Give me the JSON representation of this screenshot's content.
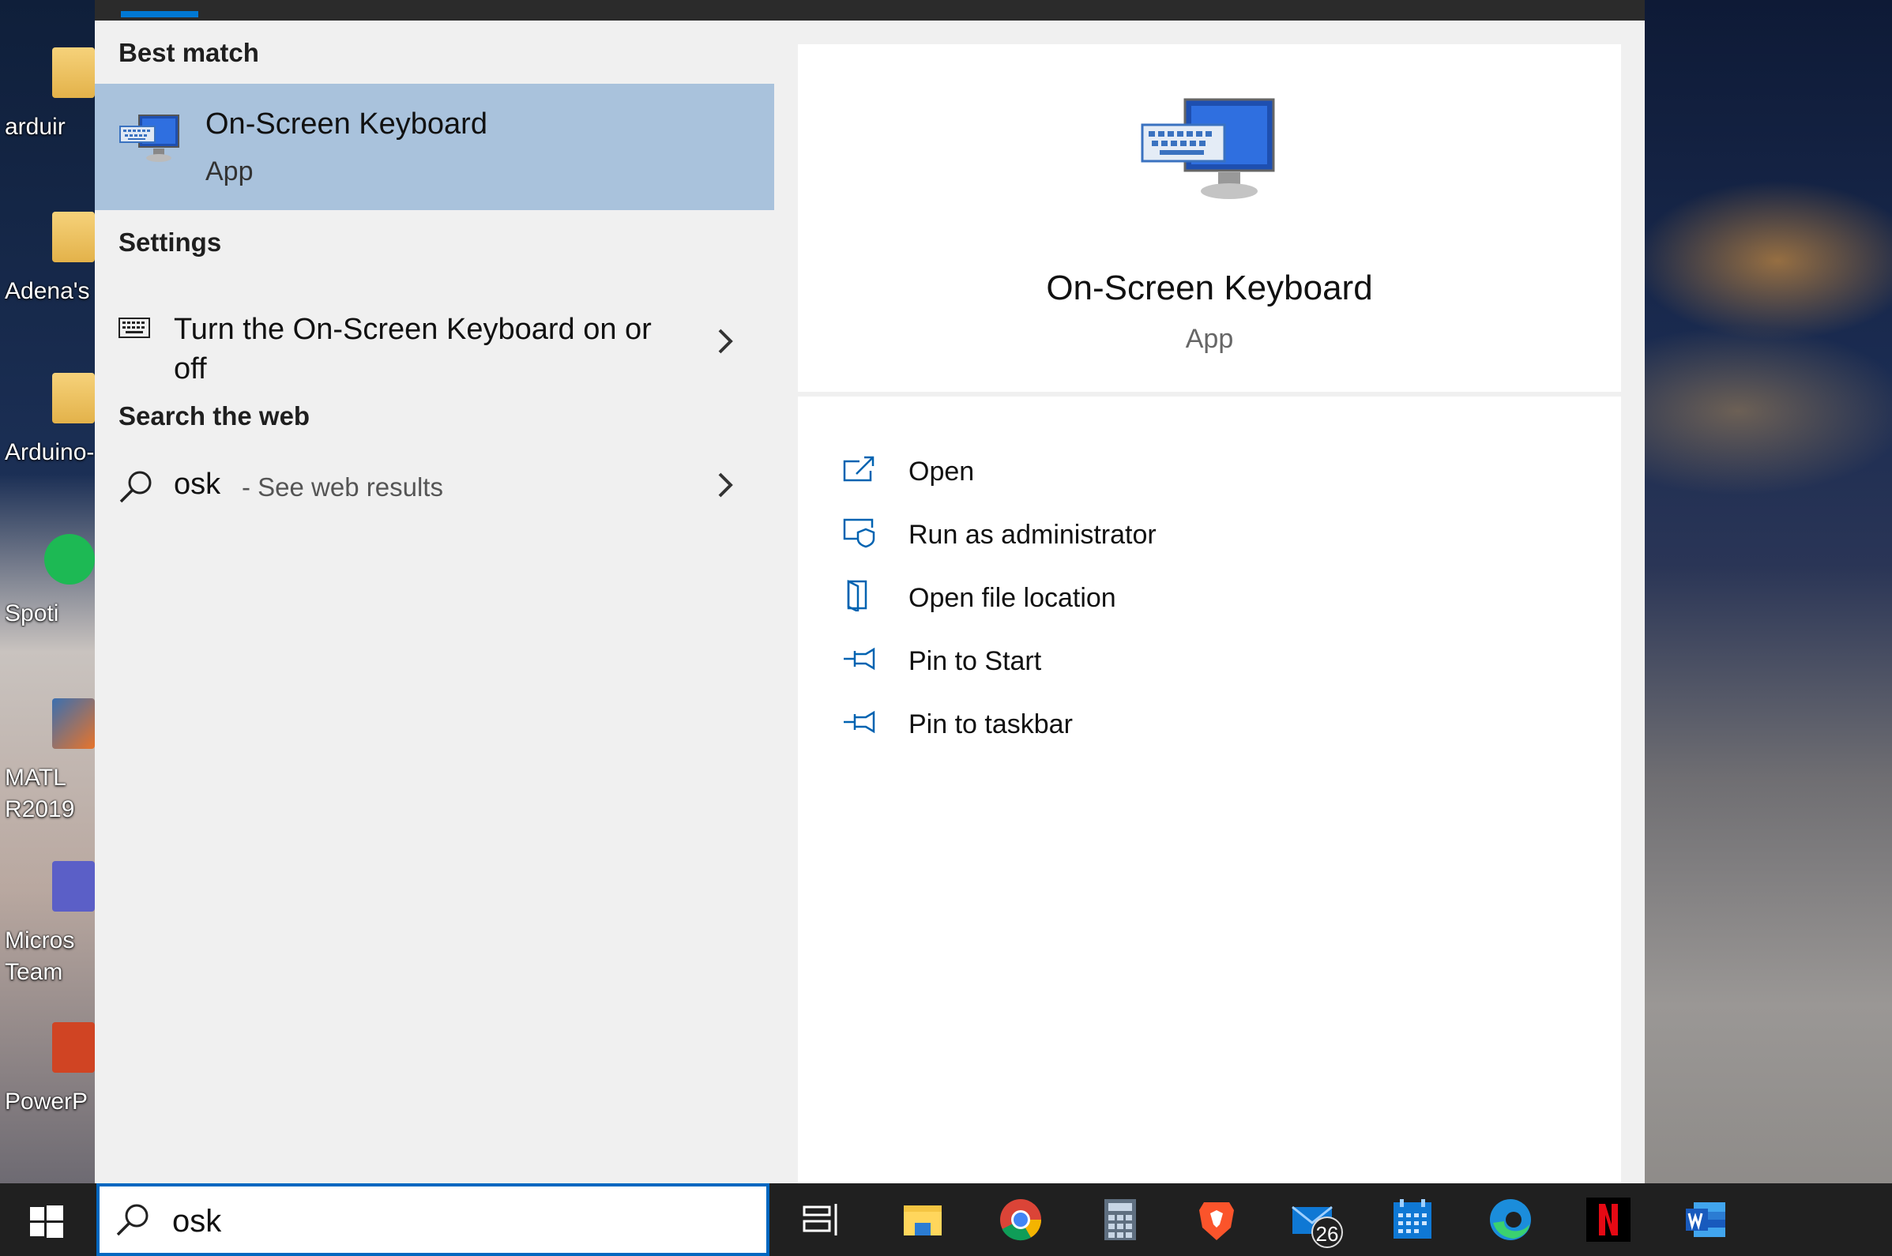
{
  "desktop": {
    "icons": [
      {
        "label": "arduir"
      },
      {
        "label": "Adena's"
      },
      {
        "label": "Arduino-"
      },
      {
        "label": "Spoti"
      },
      {
        "label": "MATL"
      },
      {
        "label": "R2019"
      },
      {
        "label": "Micros"
      },
      {
        "label": "Team"
      },
      {
        "label": "PowerP"
      }
    ]
  },
  "results": {
    "best_match_heading": "Best match",
    "best_match": {
      "title": "On-Screen Keyboard",
      "subtitle": "App"
    },
    "settings_heading": "Settings",
    "setting_item": {
      "label": "Turn the On-Screen Keyboard on or off"
    },
    "web_heading": "Search the web",
    "web_item": {
      "query": "osk",
      "hint": "- See web results"
    }
  },
  "detail": {
    "title": "On-Screen Keyboard",
    "subtitle": "App",
    "actions": [
      {
        "label": "Open",
        "icon": "open-icon"
      },
      {
        "label": "Run as administrator",
        "icon": "shield-icon"
      },
      {
        "label": "Open file location",
        "icon": "file-location-icon"
      },
      {
        "label": "Pin to Start",
        "icon": "pin-icon"
      },
      {
        "label": "Pin to taskbar",
        "icon": "pin-icon"
      }
    ]
  },
  "taskbar": {
    "search_value": "osk",
    "mail_badge": "26",
    "apps": [
      "task-view",
      "file-explorer",
      "chrome",
      "calculator",
      "brave",
      "mail",
      "calendar",
      "edge",
      "netflix",
      "word"
    ]
  },
  "colors": {
    "accent": "#0078d4",
    "selection": "#a9c2dc",
    "panel": "#f0f0f0",
    "taskbar": "#202020"
  }
}
